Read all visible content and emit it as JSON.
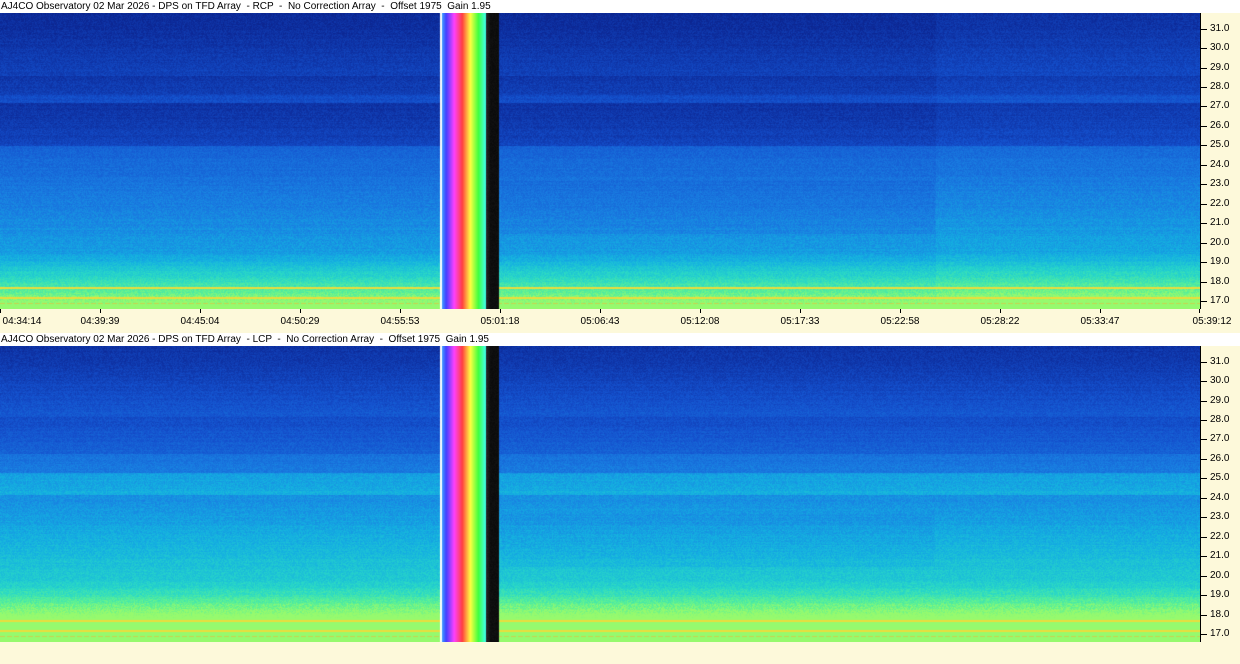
{
  "panels": [
    {
      "title": "AJ4CO Observatory 02 Mar 2026 - DPS on TFD Array  - RCP  -  No Correction Array  -  Offset 1975  Gain 1.95",
      "polarization": "RCP",
      "intensity_profile": "darker"
    },
    {
      "title": "AJ4CO Observatory 02 Mar 2026 - DPS on TFD Array  - LCP  -  No Correction Array  -  Offset 1975  Gain 1.95",
      "polarization": "LCP",
      "intensity_profile": "brighter"
    }
  ],
  "frequency_axis": {
    "labels": [
      "31.0",
      "30.0",
      "29.0",
      "28.0",
      "27.0",
      "26.0",
      "25.0",
      "24.0",
      "23.0",
      "22.0",
      "21.0",
      "20.0",
      "19.0",
      "18.0",
      "17.0"
    ],
    "range": [
      16.6,
      31.8
    ]
  },
  "time_axis": {
    "labels": [
      "04:34:14",
      "04:39:39",
      "04:45:04",
      "04:50:29",
      "04:55:53",
      "05:01:18",
      "05:06:43",
      "05:12:08",
      "05:17:33",
      "05:22:58",
      "05:28:22",
      "05:33:47",
      "05:39:12"
    ]
  },
  "colors": {
    "background": "#fdf9da",
    "colormap_low": "#0a1d7a",
    "colormap_mid": "#1e6ad8",
    "colormap_high": "#5ef0a0",
    "calibration_black": "#000000"
  }
}
